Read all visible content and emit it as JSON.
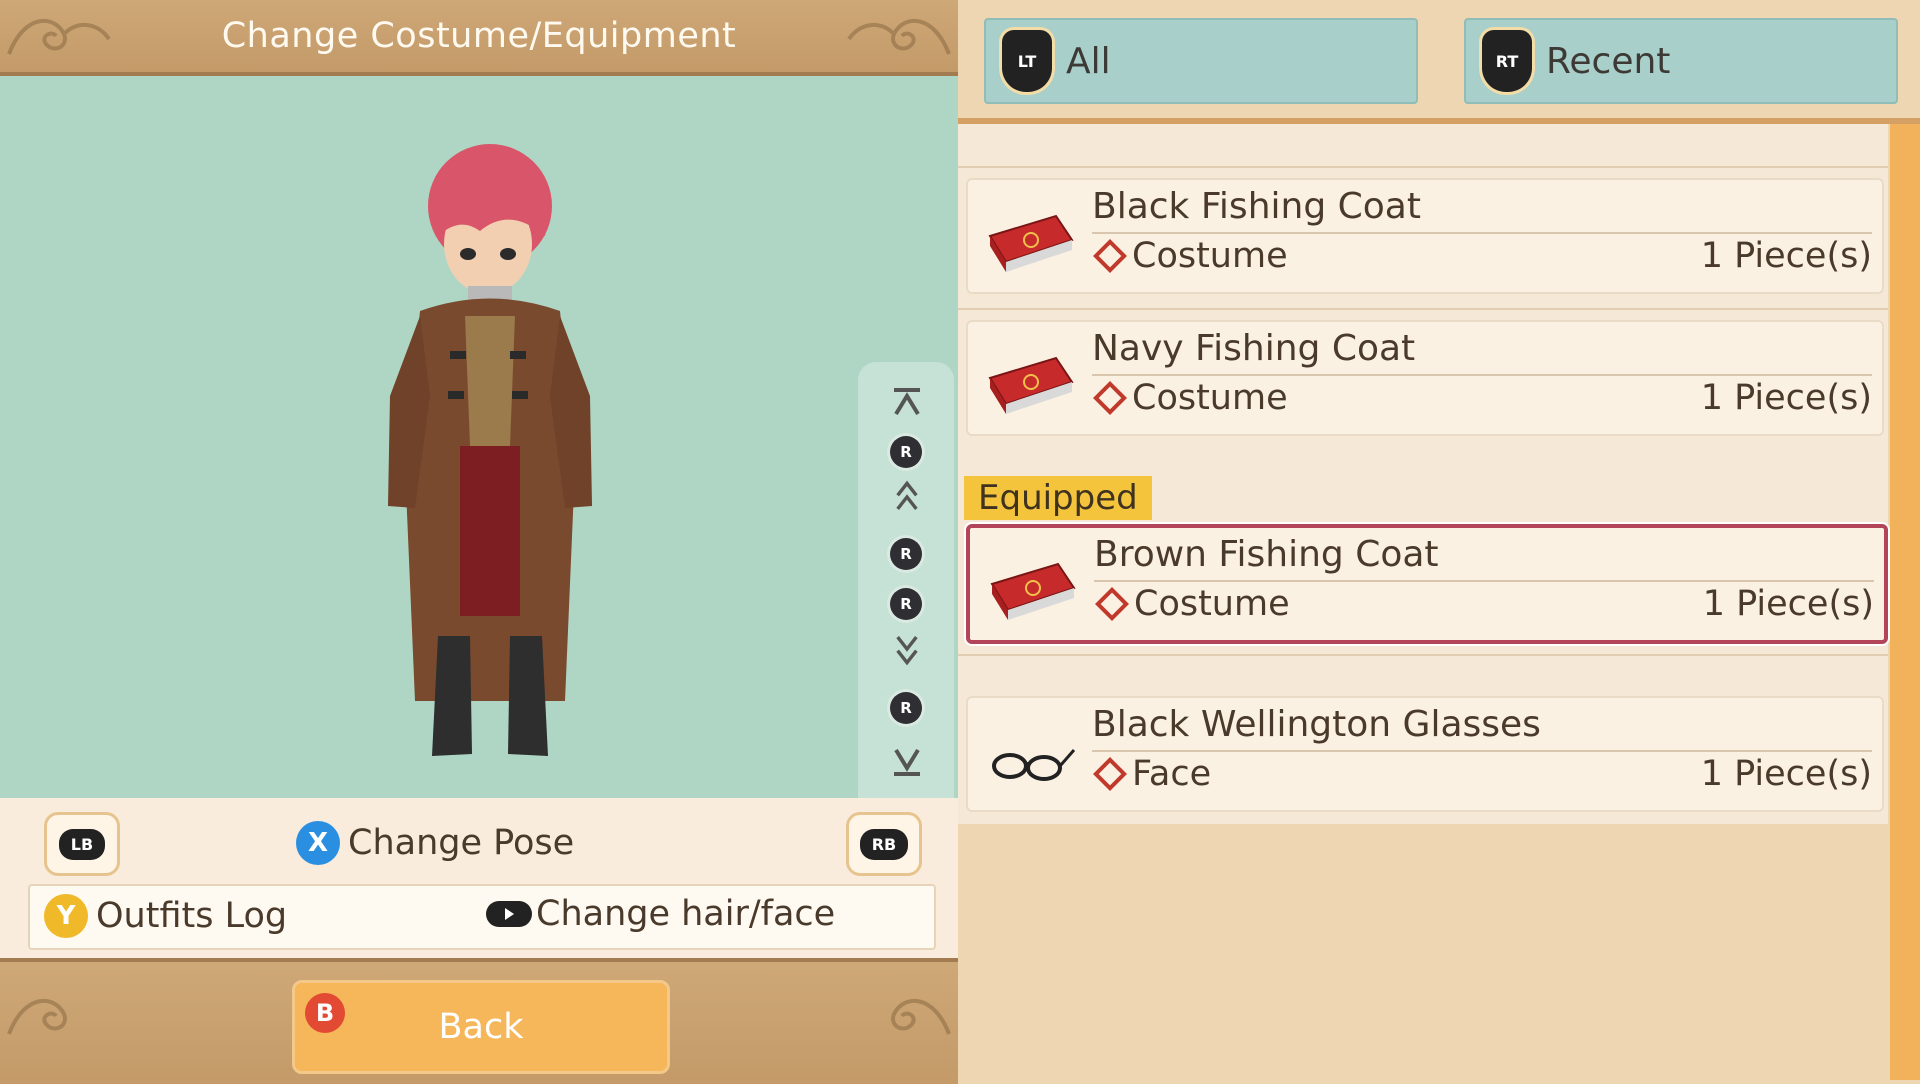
{
  "header": {
    "title": "Change Costume/Equipment"
  },
  "controls": {
    "lb_label": "LB",
    "rb_label": "RB",
    "x_button": "X",
    "change_pose": "Change Pose",
    "y_button": "Y",
    "outfits_log": "Outfits Log",
    "change_hair_face": "Change hair/face",
    "r_stick": "R"
  },
  "footer": {
    "b_button": "B",
    "back_label": "Back"
  },
  "tabs": [
    {
      "button": "LT",
      "label": "All"
    },
    {
      "button": "RT",
      "label": "Recent"
    }
  ],
  "equipped_label": "Equipped",
  "items": [
    {
      "name": "Black Fishing Coat",
      "category": "Costume",
      "quantity": "1 Piece(s)",
      "icon": "costume-case-icon",
      "selected": false
    },
    {
      "name": "Navy Fishing Coat",
      "category": "Costume",
      "quantity": "1 Piece(s)",
      "icon": "costume-case-icon",
      "selected": false
    },
    {
      "name": "Brown Fishing Coat",
      "category": "Costume",
      "quantity": "1 Piece(s)",
      "icon": "costume-case-icon",
      "selected": true
    },
    {
      "name": "Black Wellington Glasses",
      "category": "Face",
      "quantity": "1 Piece(s)",
      "icon": "glasses-icon",
      "selected": false
    }
  ],
  "colors": {
    "viewport_bg": "#afd6c5",
    "selected_border": "#b3455a",
    "equipped_tag": "#f5c43d",
    "back_button": "#f6b65a",
    "x_button": "#2a8fe0",
    "y_button": "#f0b92a",
    "b_button": "#e34a33"
  }
}
